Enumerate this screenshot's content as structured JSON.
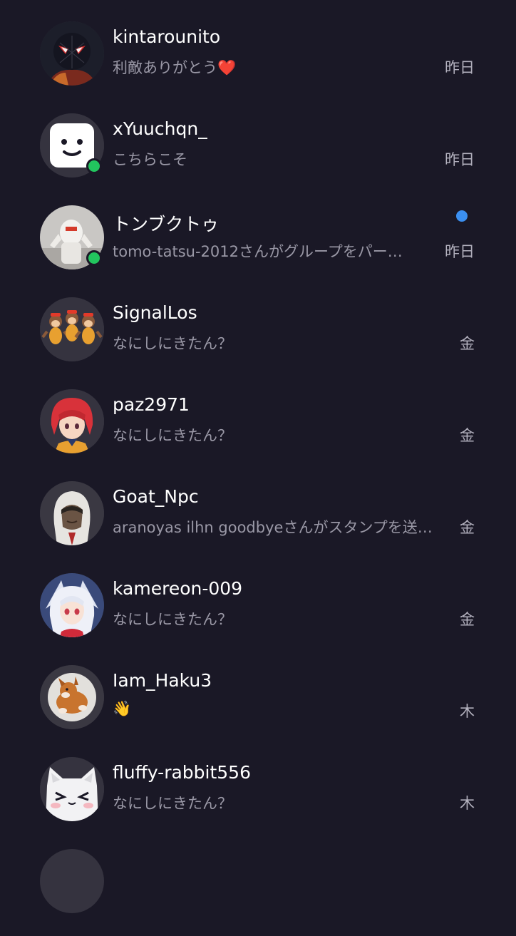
{
  "conversations": [
    {
      "name": "kintarounito",
      "preview": "利敵ありがとう",
      "preview_suffix": "❤️",
      "time": "昨日",
      "online": false,
      "unread": false,
      "avatar_icon": "spider-man-avatar-icon"
    },
    {
      "name": "xYuuchqn_",
      "preview": "こちらこそ",
      "preview_suffix": "",
      "time": "昨日",
      "online": true,
      "unread": false,
      "avatar_icon": "smiley-face-avatar-icon"
    },
    {
      "name": "トンブクトゥ",
      "preview": "tomo-tatsu-2012さんがグループをパー…",
      "preview_suffix": "",
      "time": "昨日",
      "online": true,
      "unread": true,
      "avatar_icon": "white-robot-avatar-icon"
    },
    {
      "name": "SignalLos",
      "preview": "なにしにきたん？",
      "preview_suffix": "",
      "time": "金",
      "online": false,
      "unread": false,
      "avatar_icon": "monkeys-avatar-icon"
    },
    {
      "name": "paz2971",
      "preview": "なにしにきたん？",
      "preview_suffix": "",
      "time": "金",
      "online": false,
      "unread": false,
      "avatar_icon": "red-hair-girl-avatar-icon"
    },
    {
      "name": "Goat_Npc",
      "preview": "aranoyas ilhn goodbyeさんがスタンプを送…",
      "preview_suffix": "",
      "time": "金",
      "online": false,
      "unread": false,
      "avatar_icon": "hooded-assassin-avatar-icon"
    },
    {
      "name": "kamereon-009",
      "preview": "なにしにきたん？",
      "preview_suffix": "",
      "time": "金",
      "online": false,
      "unread": false,
      "avatar_icon": "white-hair-girl-avatar-icon"
    },
    {
      "name": "Iam_Haku3",
      "preview": "👋",
      "preview_suffix": "",
      "time": "木",
      "online": false,
      "unread": false,
      "avatar_icon": "puppy-avatar-icon"
    },
    {
      "name": "fluffy-rabbit556",
      "preview": "なにしにきたん？",
      "preview_suffix": "",
      "time": "木",
      "online": false,
      "unread": false,
      "avatar_icon": "white-cat-avatar-icon"
    }
  ],
  "colors": {
    "background": "#1a1826",
    "online": "#22c55e",
    "unread": "#3b8ff0",
    "preview_text": "#9a98a6"
  }
}
